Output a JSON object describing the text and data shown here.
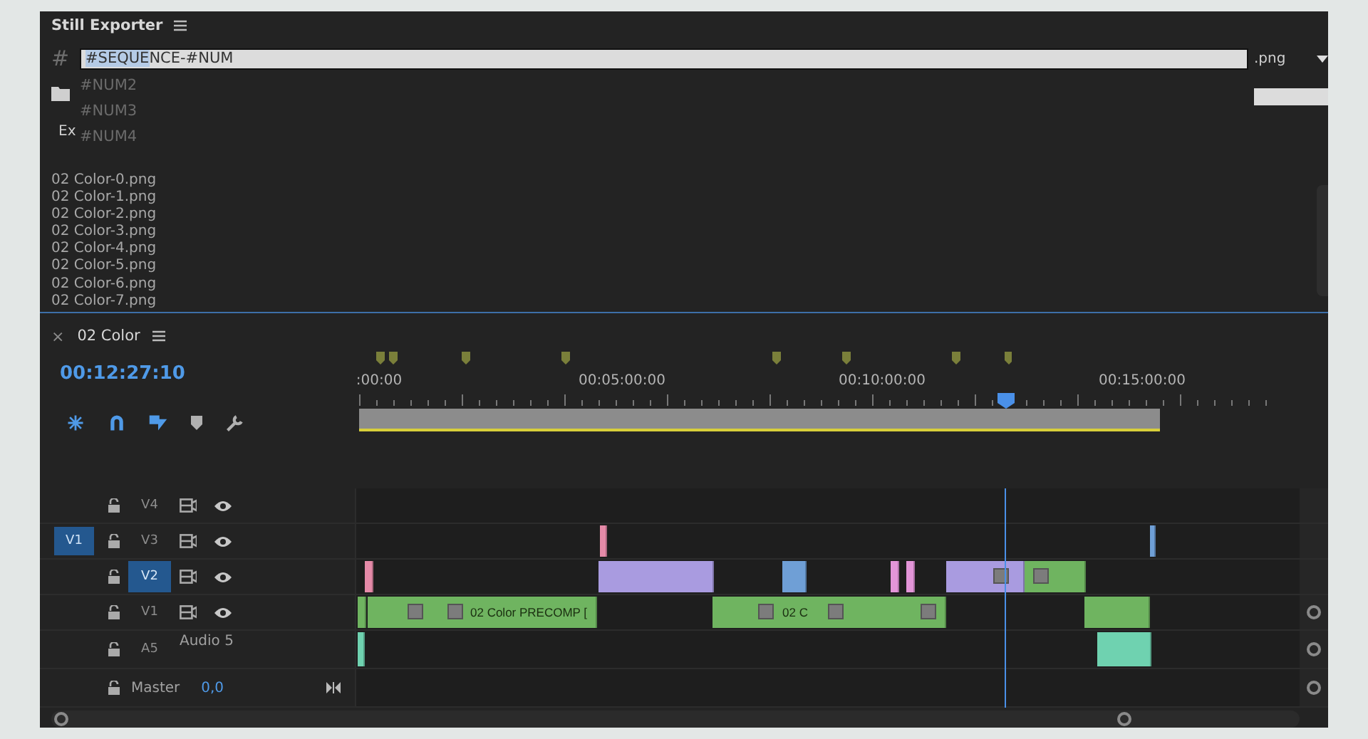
{
  "exporter": {
    "title": "Still Exporter",
    "pattern_symbol": "#",
    "filename_field": {
      "selected_text": "#SEQUE",
      "rest_text": "NCE-#NUM"
    },
    "extension": ".png",
    "suggestions": [
      "#NUM2",
      "#NUM3",
      "#NUM4"
    ],
    "export_label": "Ex",
    "files": [
      "02 Color-0.png",
      "02 Color-1.png",
      "02 Color-2.png",
      "02 Color-3.png",
      "02 Color-4.png",
      "02 Color-5.png",
      "02 Color-6.png",
      "02 Color-7.png"
    ]
  },
  "timeline": {
    "close_symbol": "×",
    "title": "02 Color",
    "timecode": "00:12:27:10",
    "tools": [
      {
        "kind": "snap",
        "on": true
      },
      {
        "kind": "magnet",
        "on": true
      },
      {
        "kind": "linked",
        "on": true
      },
      {
        "kind": "marker",
        "on": false
      },
      {
        "kind": "wrench",
        "on": false
      }
    ],
    "ruler_labels": [
      ":00:00",
      "00:05:00:00",
      "00:10:00:00",
      "00:15:00:00"
    ],
    "tracks": [
      {
        "kind": "video",
        "label": "V4",
        "targeted": false
      },
      {
        "kind": "video",
        "label": "V3",
        "targeted": false,
        "source_patch": {
          "label": "V1",
          "selected": true
        }
      },
      {
        "kind": "video",
        "label": "V2",
        "targeted": true
      },
      {
        "kind": "video",
        "label": "V1",
        "targeted": false,
        "clip_labels": [
          "02 Color PRECOMP [",
          "02 C"
        ]
      },
      {
        "kind": "audio",
        "label": "A5",
        "name": "Audio 5"
      },
      {
        "kind": "master",
        "name": "Master",
        "value": "0,0"
      }
    ]
  }
}
